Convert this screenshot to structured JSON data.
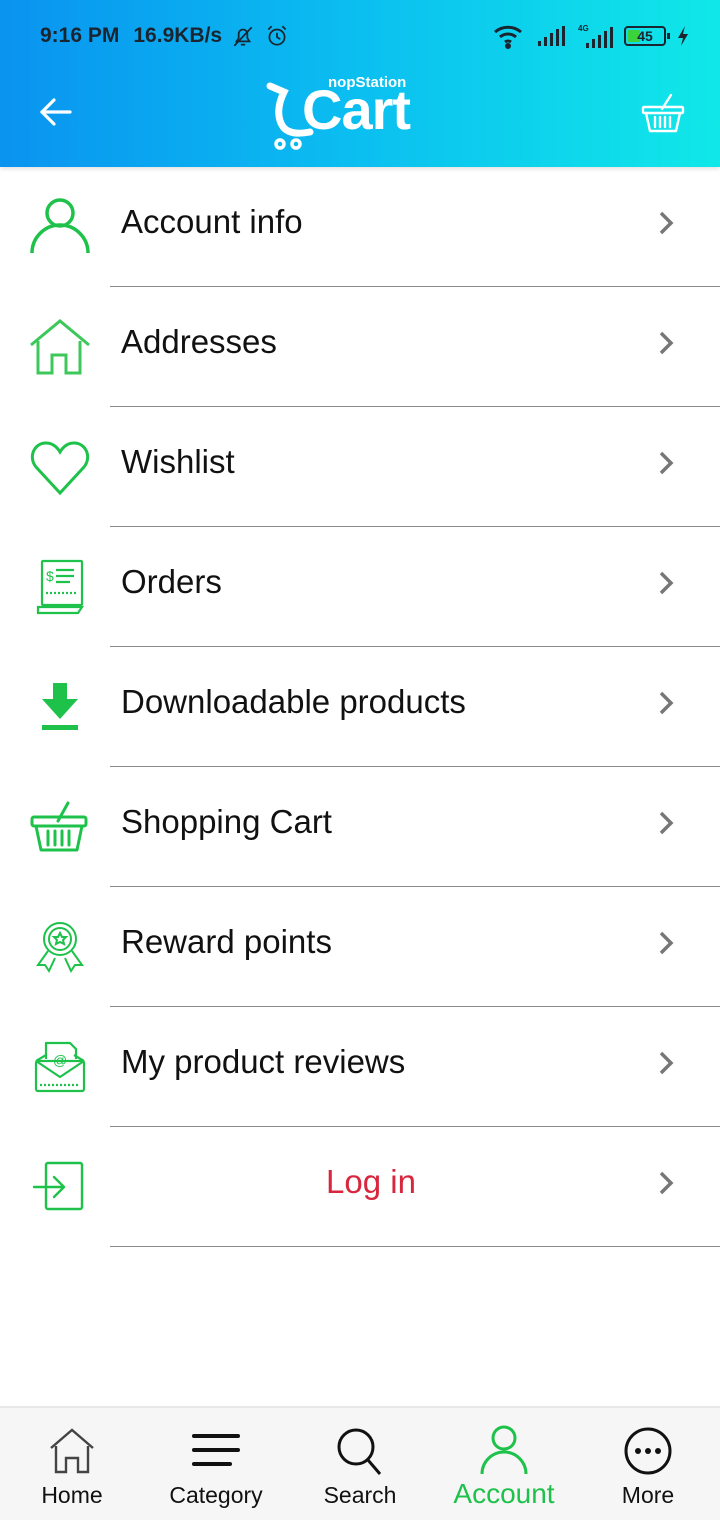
{
  "status_bar": {
    "time": "9:16 PM",
    "net_speed": "16.9KB/s",
    "battery": "45",
    "icons": [
      "bell-off-icon",
      "alarm-icon",
      "wifi-icon",
      "signal-icon",
      "signal-4g-icon",
      "battery-icon",
      "charging-icon"
    ]
  },
  "header": {
    "back_icon": "arrow-left-icon",
    "logo_small": "nopStation",
    "logo_big": "Cart",
    "cart_icon": "basket-icon"
  },
  "colors": {
    "accent": "#1ec24a",
    "login": "#d7263d",
    "header_start": "#0a93f0",
    "header_end": "#10e8e8"
  },
  "menu": {
    "items": [
      {
        "label": "Account info",
        "icon": "user-icon"
      },
      {
        "label": "Addresses",
        "icon": "house-icon"
      },
      {
        "label": "Wishlist",
        "icon": "heart-icon"
      },
      {
        "label": "Orders",
        "icon": "receipt-icon"
      },
      {
        "label": "Downloadable products",
        "icon": "download-icon"
      },
      {
        "label": "Shopping Cart",
        "icon": "basket-icon"
      },
      {
        "label": "Reward points",
        "icon": "award-badge-icon"
      },
      {
        "label": "My product reviews",
        "icon": "mail-at-icon"
      },
      {
        "label": "Log in",
        "icon": "login-icon"
      }
    ]
  },
  "bottom_nav": {
    "items": [
      {
        "label": "Home",
        "icon": "home-icon",
        "active": false
      },
      {
        "label": "Category",
        "icon": "menu-icon",
        "active": false
      },
      {
        "label": "Search",
        "icon": "search-icon",
        "active": false
      },
      {
        "label": "Account",
        "icon": "user-icon",
        "active": true
      },
      {
        "label": "More",
        "icon": "more-icon",
        "active": false
      }
    ]
  }
}
